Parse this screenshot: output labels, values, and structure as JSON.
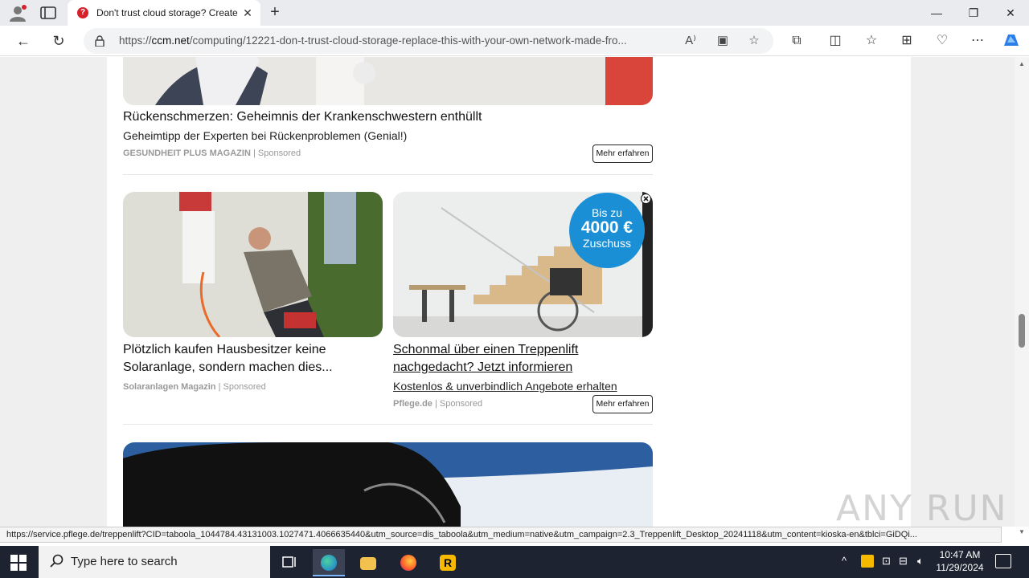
{
  "tab": {
    "title": "Don't trust cloud storage? Create",
    "close": "✕",
    "new": "+"
  },
  "window": {
    "minimize": "—",
    "maximize": "❐",
    "close": "✕"
  },
  "address": {
    "prefix": "https://",
    "host": "ccm.net",
    "path": "/computing/12221-don-t-trust-cloud-storage-replace-this-with-your-own-network-made-fro..."
  },
  "toolbar": {
    "back": "←",
    "reload": "↻"
  },
  "ads": {
    "first": {
      "title": "Rückenschmerzen: Geheimnis der Krankenschwestern enthüllt",
      "desc": "Geheimtipp der Experten bei Rückenproblemen (Genial!)",
      "source": "GESUNDHEIT PLUS MAGAZIN",
      "sponsored": "| Sponsored",
      "cta": "Mehr erfahren"
    },
    "left": {
      "title": "Plötzlich kaufen Hausbesitzer keine Solaranlage, sondern machen dies...",
      "source": "Solaranlagen Magazin",
      "sponsored": "| Sponsored"
    },
    "right": {
      "title": "Schonmal über einen Treppenlift nachgedacht? Jetzt informieren",
      "desc": "Kostenlos & unverbindlich Angebote erhalten",
      "source": "Pflege.de",
      "sponsored": "| Sponsored",
      "cta": "Mehr erfahren",
      "badge_line1": "Bis zu",
      "badge_line2": "4000 €",
      "badge_line3": "Zuschuss"
    }
  },
  "status_url": "https://service.pflege.de/treppenlift?CID=taboola_1044784.43131003.1027471.4066635440&utm_source=dis_taboola&utm_medium=native&utm_campaign=2.3_Treppenlift_Desktop_20241118&utm_content=kioska-en&tblci=GiDQi...",
  "watermark": "ANY RUN",
  "taskbar": {
    "search_placeholder": "Type here to search",
    "time": "10:47 AM",
    "date": "11/29/2024"
  },
  "colors": {
    "accent": "#1a73e8",
    "badge": "#1b8fd6",
    "taskbar": "#1d2330"
  }
}
